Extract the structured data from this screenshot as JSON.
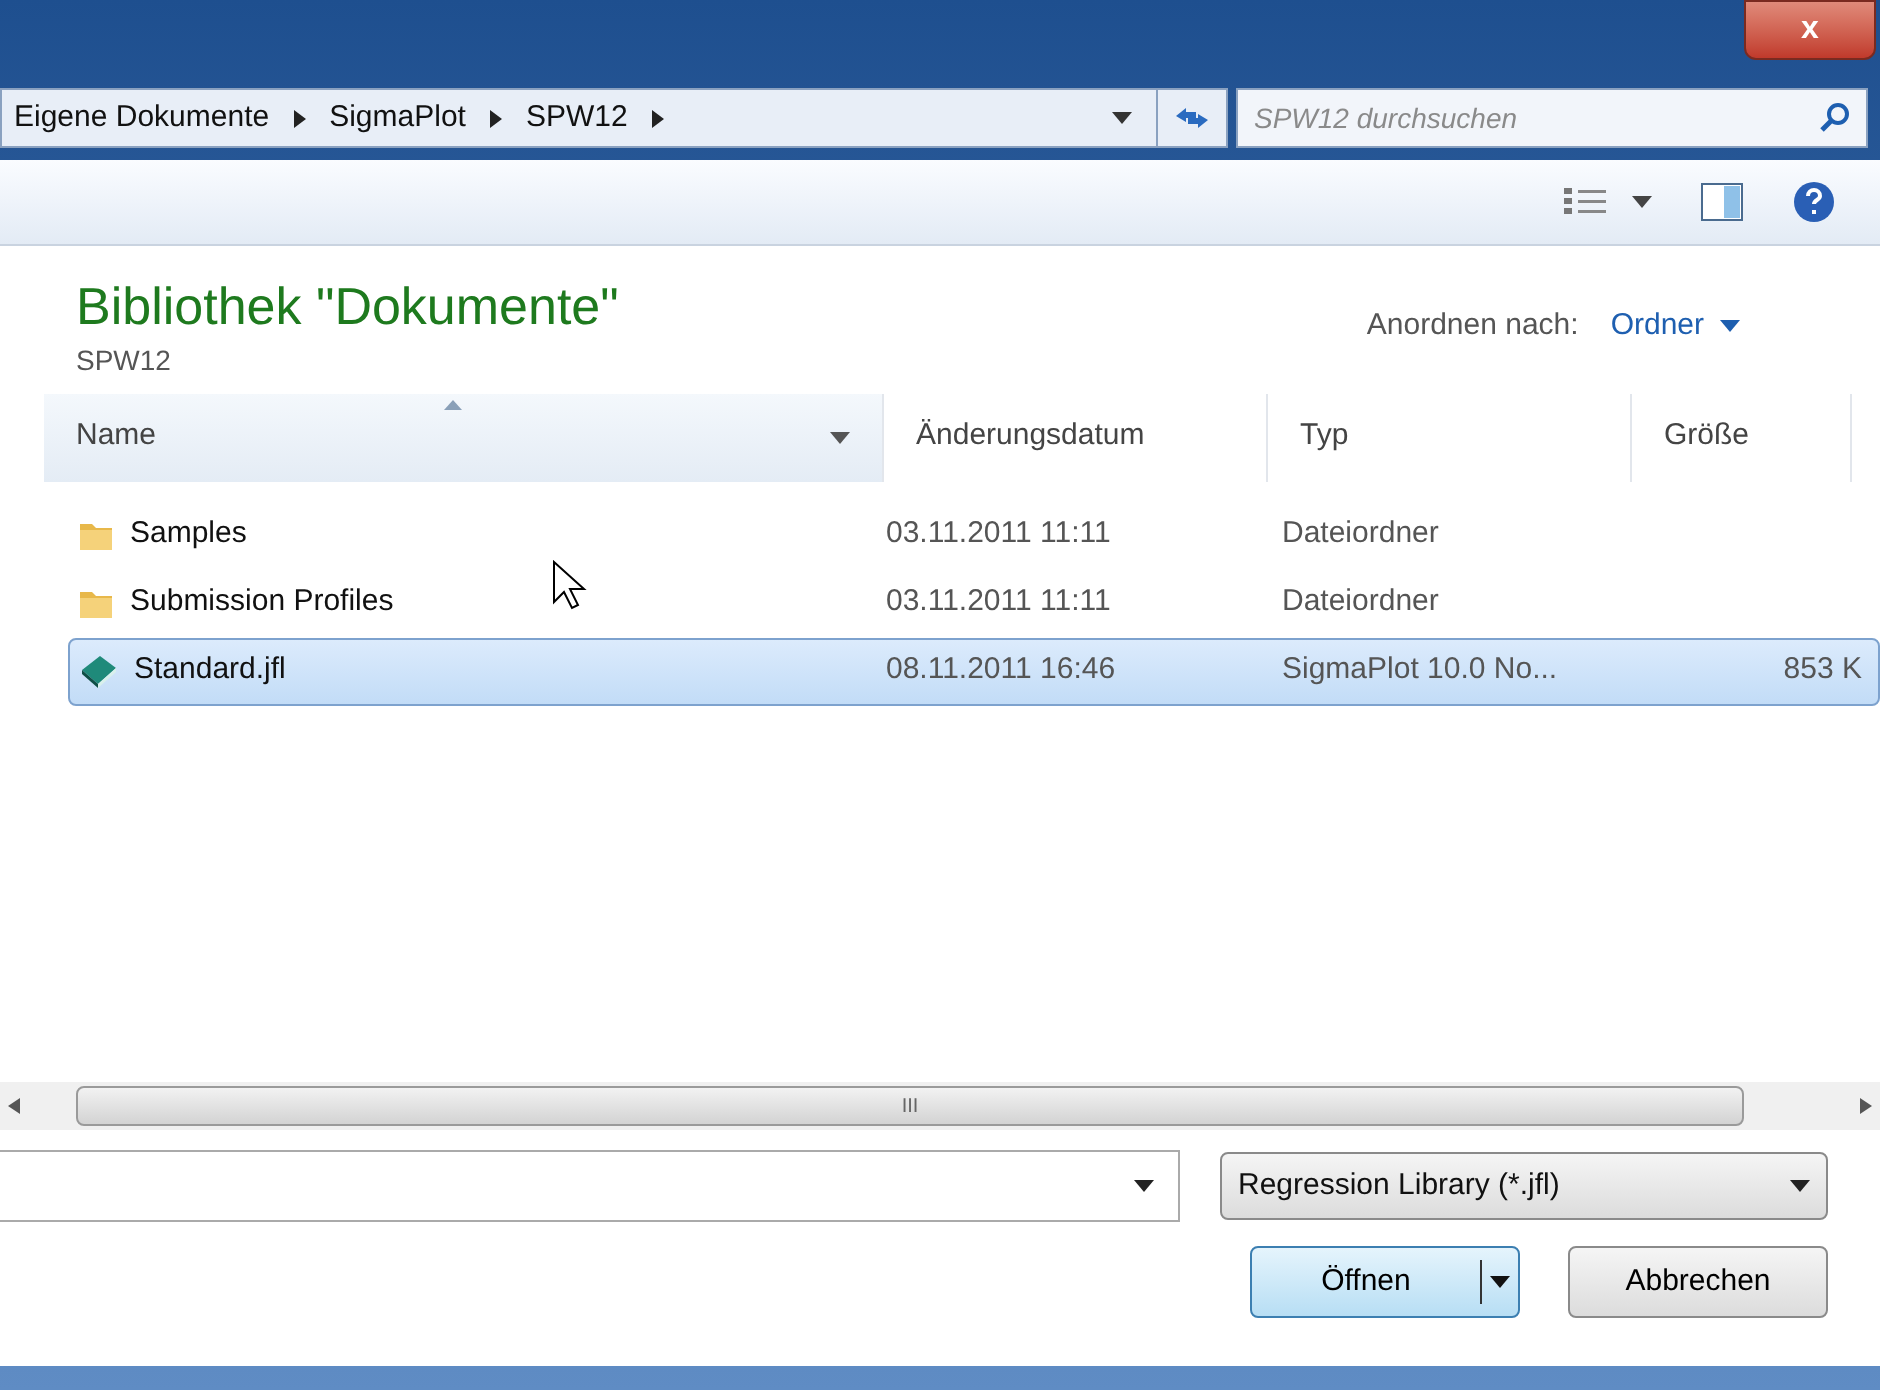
{
  "title_bar": {
    "close": "x"
  },
  "address_bar": {
    "path": [
      {
        "label": "Eigene Dokumente"
      },
      {
        "label": "SigmaPlot"
      },
      {
        "label": "SPW12"
      }
    ],
    "search": {
      "placeholder": "SPW12 durchsuchen"
    }
  },
  "library": {
    "title": "Bibliothek \"Dokumente\"",
    "subtitle": "SPW12",
    "arrange_label": "Anordnen nach:",
    "arrange_value": "Ordner"
  },
  "table": {
    "columns": [
      "Name",
      "Änderungsdatum",
      "Typ",
      "Größe"
    ],
    "rows": [
      {
        "kind": "folder",
        "name": "Samples",
        "date": "03.11.2011 11:11",
        "type": "Dateiordner",
        "size": "",
        "selected": false
      },
      {
        "kind": "folder",
        "name": "Submission Profiles",
        "date": "03.11.2011 11:11",
        "type": "Dateiordner",
        "size": "",
        "selected": false
      },
      {
        "kind": "file",
        "name": "Standard.jfl",
        "date": "08.11.2011 16:46",
        "type": "SigmaPlot 10.0 No...",
        "size": "853 K",
        "selected": true
      }
    ]
  },
  "scrollbar": {
    "grip": "III"
  },
  "footer": {
    "filter": "Regression Library (*.jfl)",
    "buttons": [
      {
        "label": "Öffnen",
        "kind": "split"
      },
      {
        "label": "Abbrechen",
        "kind": "plain"
      }
    ]
  }
}
